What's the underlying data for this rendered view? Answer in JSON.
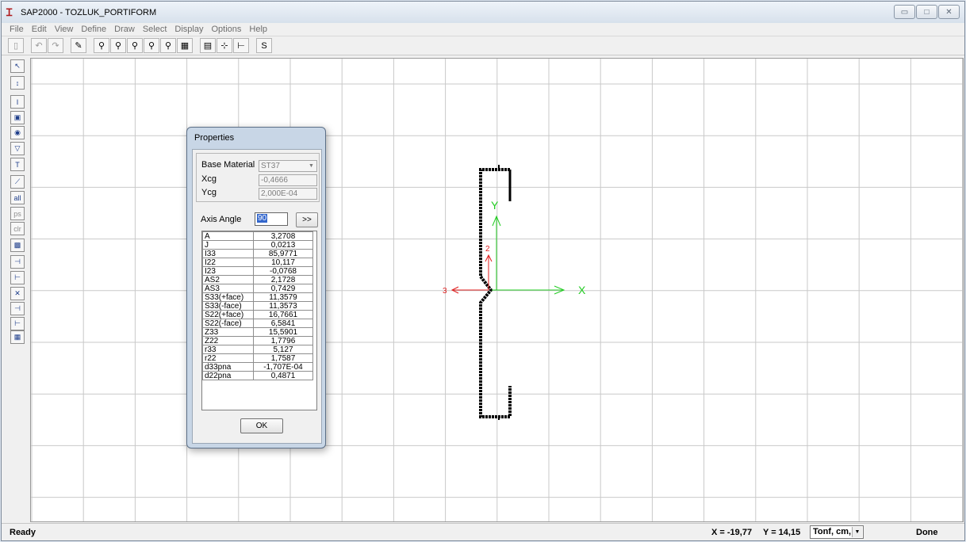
{
  "window": {
    "title": "SAP2000 - TOZLUK_PORTIFORM",
    "app_icon": "sap2000-icon",
    "caption_buttons": [
      "minimize-icon",
      "maximize-icon",
      "close-icon"
    ]
  },
  "menu": [
    "File",
    "Edit",
    "View",
    "Define",
    "Draw",
    "Select",
    "Display",
    "Options",
    "Help"
  ],
  "toolbar": {
    "buttons": [
      {
        "name": "new-file-icon",
        "glyph": "▯",
        "dim": true
      },
      {
        "name": "undo-icon",
        "glyph": "↶",
        "dim": true
      },
      {
        "name": "redo-icon",
        "glyph": "↷",
        "dim": true
      },
      {
        "name": "pencil-icon",
        "glyph": "✎"
      },
      {
        "name": "zoom-rubber-band-icon",
        "glyph": "⚲"
      },
      {
        "name": "restore-full-view-icon",
        "glyph": "⚲"
      },
      {
        "name": "zoom-previous-icon",
        "glyph": "⚲"
      },
      {
        "name": "zoom-in-icon",
        "glyph": "⚲"
      },
      {
        "name": "zoom-out-icon",
        "glyph": "⚲"
      },
      {
        "name": "pan-icon",
        "glyph": "▦"
      },
      {
        "name": "section-properties-icon",
        "glyph": "▤"
      },
      {
        "name": "snap-icon",
        "glyph": "⊹"
      },
      {
        "name": "reference-point-icon",
        "glyph": "⊢"
      },
      {
        "name": "stress-icon",
        "glyph": "S"
      }
    ]
  },
  "left_tools": [
    {
      "name": "pointer-icon",
      "glyph": "↖"
    },
    {
      "name": "reshape-icon",
      "glyph": "↕"
    },
    {
      "name": "draw-i-section-icon",
      "glyph": "I"
    },
    {
      "name": "draw-rectangle-icon",
      "glyph": "▣"
    },
    {
      "name": "draw-circle-icon",
      "glyph": "◉"
    },
    {
      "name": "draw-polygon-icon",
      "glyph": "▽"
    },
    {
      "name": "draw-t-section-icon",
      "glyph": "T"
    },
    {
      "name": "draw-line-icon",
      "glyph": "⟋"
    },
    {
      "name": "all-icon",
      "glyph": "all"
    },
    {
      "name": "ps-icon",
      "glyph": "ps",
      "dim": true
    },
    {
      "name": "clr-icon",
      "glyph": "clr",
      "dim": true
    },
    {
      "name": "mesh-icon",
      "glyph": "▩"
    },
    {
      "name": "snap-points-icon",
      "glyph": "⊣"
    },
    {
      "name": "snap-ends-icon",
      "glyph": "⊢"
    },
    {
      "name": "snap-intersection-icon",
      "glyph": "✕"
    },
    {
      "name": "snap-midpoint-icon",
      "glyph": "⊣"
    },
    {
      "name": "snap-perpendicular-icon",
      "glyph": "⊢"
    },
    {
      "name": "snap-grid-icon",
      "glyph": "▦"
    }
  ],
  "canvas": {
    "x_axis_label": "X",
    "y_axis_label": "Y",
    "local_axis_2_label": "2",
    "local_axis_3_label": "3",
    "colors": {
      "global_axes": "#22cc22",
      "local_axes": "#e01e1e",
      "section": "#000000",
      "grid": "#c9c9c9"
    }
  },
  "properties_dialog": {
    "title": "Properties",
    "base_material_label": "Base Material",
    "base_material_value": "ST37",
    "xcg_label": "Xcg",
    "xcg_value": "-0,4666",
    "ycg_label": "Ycg",
    "ycg_value": "2,000E-04",
    "axis_angle_label": "Axis Angle",
    "axis_angle_value": "90",
    "more_button": ">>",
    "ok_button": "OK",
    "properties": [
      {
        "name": "A",
        "value": "3,2708"
      },
      {
        "name": "J",
        "value": "0,0213"
      },
      {
        "name": "I33",
        "value": "85,9771"
      },
      {
        "name": "I22",
        "value": "10,117"
      },
      {
        "name": "I23",
        "value": "-0,0768"
      },
      {
        "name": "AS2",
        "value": "2,1728"
      },
      {
        "name": "AS3",
        "value": "0,7429"
      },
      {
        "name": "S33(+face)",
        "value": "11,3579"
      },
      {
        "name": "S33(-face)",
        "value": "11,3573"
      },
      {
        "name": "S22(+face)",
        "value": "16,7661"
      },
      {
        "name": "S22(-face)",
        "value": "6,5841"
      },
      {
        "name": "Z33",
        "value": "15,5901"
      },
      {
        "name": "Z22",
        "value": "1,7796"
      },
      {
        "name": "r33",
        "value": "5,127"
      },
      {
        "name": "r22",
        "value": "1,7587"
      },
      {
        "name": "d33pna",
        "value": "-1,707E-04"
      },
      {
        "name": "d22pna",
        "value": "0,4871"
      }
    ]
  },
  "status": {
    "ready": "Ready",
    "x_coord": "X = -19,77",
    "y_coord": "Y = 14,15",
    "units": "Tonf, cm, C",
    "done": "Done"
  }
}
